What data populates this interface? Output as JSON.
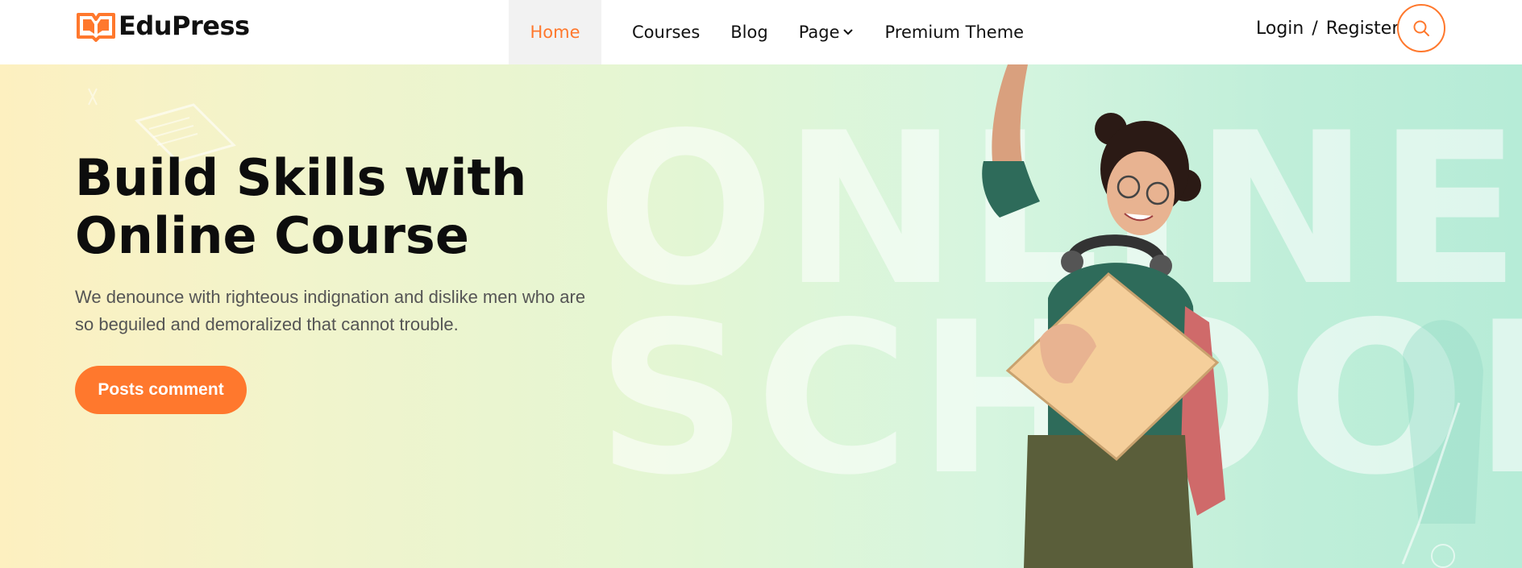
{
  "brand": {
    "name": "EduPress",
    "color": "#ff782d"
  },
  "nav": {
    "items": [
      {
        "label": "Home",
        "active": true
      },
      {
        "label": "Courses"
      },
      {
        "label": "Blog"
      },
      {
        "label": "Page"
      },
      {
        "label": "Premium Theme"
      }
    ]
  },
  "auth": {
    "login": "Login",
    "separator": "/",
    "register": "Register"
  },
  "search": {
    "icon": "search-icon"
  },
  "hero": {
    "title_line1": "Build Skills with",
    "title_line2": "Online Course",
    "description_line1": "We denounce with righteous indignation and dislike men who are",
    "description_line2": "so beguiled and demoralized that cannot trouble.",
    "cta_label": "Posts comment",
    "bg_word_1": "ONLINE",
    "bg_word_2": "SCHOOL"
  }
}
